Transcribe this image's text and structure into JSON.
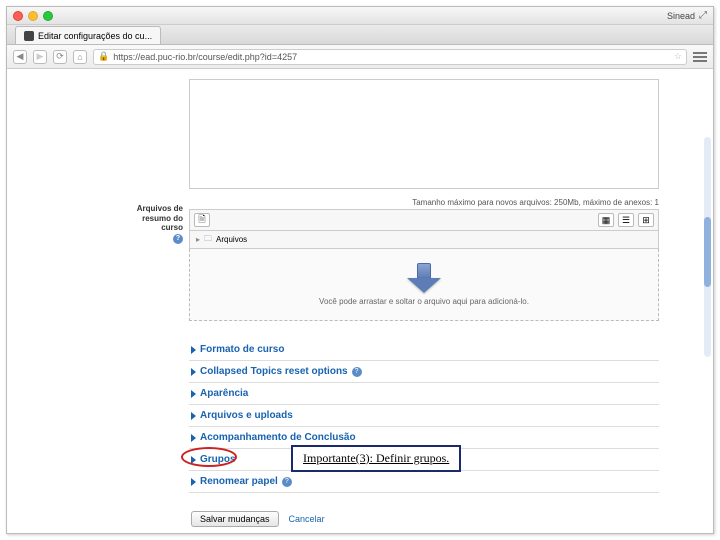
{
  "window": {
    "user_label": "Sinead",
    "tab_title": "Editar configurações do cu..."
  },
  "browser": {
    "url": "https://ead.puc-rio.br/course/edit.php?id=4257"
  },
  "form": {
    "summary_files_label": "Arquivos de resumo do curso",
    "file_size_hint": "Tamanho máximo para novos arquivos: 250Mb, máximo de anexos: 1",
    "files_folder_label": "Arquivos",
    "dropzone_text": "Você pode arrastar e soltar o arquivo aqui para adicioná-lo."
  },
  "sections": {
    "formato": "Formato de curso",
    "collapsed": "Collapsed Topics reset options",
    "aparencia": "Aparência",
    "arquivos": "Arquivos e uploads",
    "acompanhamento": "Acompanhamento de Conclusão",
    "grupos": "Grupos",
    "renomear": "Renomear papel"
  },
  "actions": {
    "save": "Salvar mudanças",
    "cancel": "Cancelar"
  },
  "annotation": {
    "text": "Importante(3): Definir grupos."
  }
}
